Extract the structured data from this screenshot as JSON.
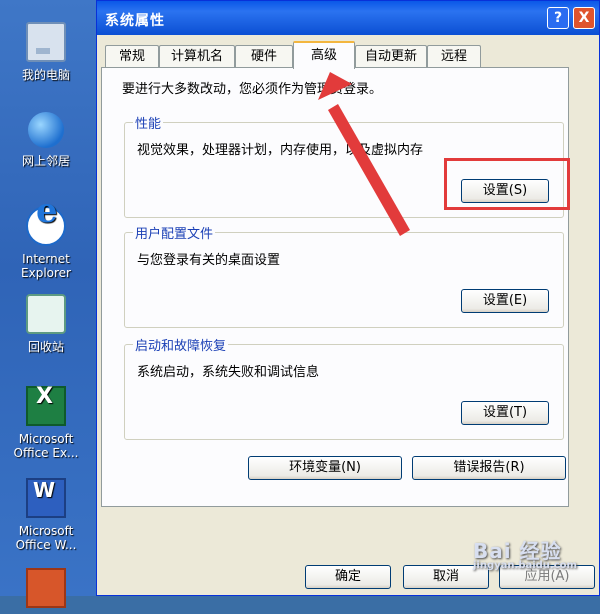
{
  "desktop": {
    "icons": [
      {
        "label": "我的电脑",
        "icon": "computer-icon"
      },
      {
        "label": "网上邻居",
        "icon": "network-icon"
      },
      {
        "label": "Internet\nExplorer",
        "icon": "internet-explorer-icon"
      },
      {
        "label": "回收站",
        "icon": "recycle-bin-icon"
      },
      {
        "label": "Microsoft\nOffice Ex...",
        "icon": "excel-icon"
      },
      {
        "label": "Microsoft\nOffice W...",
        "icon": "word-icon"
      }
    ]
  },
  "window": {
    "title": "系统属性",
    "help_button": "?",
    "close_button": "X",
    "tabs": [
      {
        "label": "常规"
      },
      {
        "label": "计算机名"
      },
      {
        "label": "硬件"
      },
      {
        "label": "高级",
        "active": true
      },
      {
        "label": "自动更新"
      },
      {
        "label": "远程"
      }
    ],
    "admin_note": "要进行大多数改动，您必须作为管理员登录。",
    "groups": {
      "performance": {
        "title": "性能",
        "description": "视觉效果，处理器计划，内存使用，以及虚拟内存",
        "button": "设置(S)"
      },
      "user_profiles": {
        "title": "用户配置文件",
        "description": "与您登录有关的桌面设置",
        "button": "设置(E)"
      },
      "startup_recovery": {
        "title": "启动和故障恢复",
        "description": "系统启动，系统失败和调试信息",
        "button": "设置(T)"
      }
    },
    "env_button": "环境变量(N)",
    "error_report_button": "错误报告(R)",
    "ok_button": "确定",
    "cancel_button": "取消",
    "apply_button": "应用(A)"
  },
  "colors": {
    "annotation": "#e23b3b",
    "titlebar": "#0a58e8",
    "dialog_bg": "#ece9d8"
  },
  "watermark": {
    "main": "Bai 经验",
    "sub": "jingyan.baidu.com"
  }
}
